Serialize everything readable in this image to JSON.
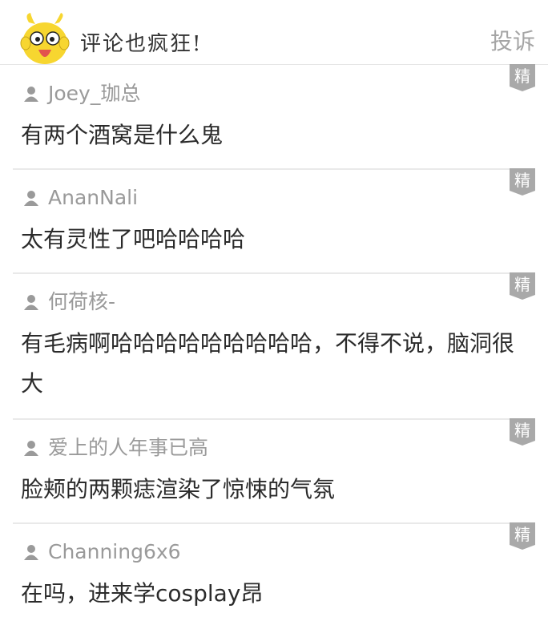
{
  "header": {
    "title": "评论也疯狂!",
    "report_label": "投诉"
  },
  "badge_label": "精",
  "comments": [
    {
      "username": "Joey_珈总",
      "content": "有两个酒窝是什么鬼"
    },
    {
      "username": "AnanNali",
      "content": "太有灵性了吧哈哈哈哈"
    },
    {
      "username": "何荷核-",
      "content": "有毛病啊哈哈哈哈哈哈哈哈哈，不得不说，脑洞很大"
    },
    {
      "username": "爱上的人年事已高",
      "content": "脸颊的两颗痣渲染了惊悚的气氛"
    },
    {
      "username": "Channing6x6",
      "content": "在吗，进来学cosplay昂"
    }
  ],
  "colors": {
    "badge": "#a9a9a9",
    "username": "#9a9a9a",
    "divider": "#e9e9e9",
    "mascot": "#f7d630"
  }
}
